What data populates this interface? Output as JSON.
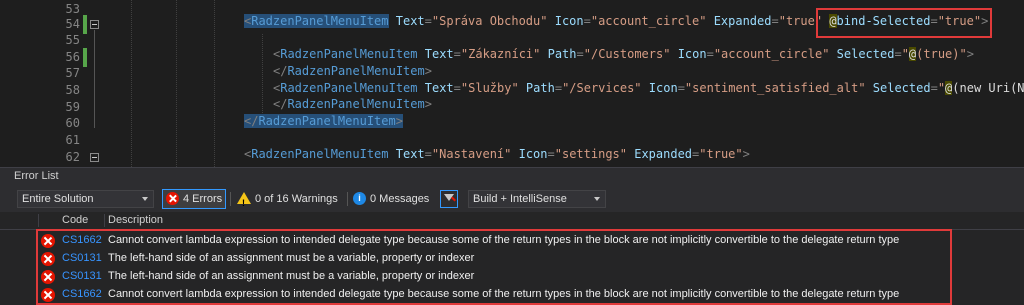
{
  "editor": {
    "line_numbers": [
      "53",
      "54",
      "55",
      "56",
      "57",
      "58",
      "59",
      "60",
      "61",
      "62"
    ],
    "lines": [
      {
        "id": "54",
        "parts": [
          [
            "punct",
            "<"
          ],
          [
            "tag",
            "RadzenPanelMenuItem"
          ],
          [
            "plain",
            " "
          ],
          [
            "attr",
            "Text"
          ],
          [
            "punct",
            "="
          ],
          [
            "str",
            "\"Správa Obchodu\""
          ],
          [
            "plain",
            " "
          ],
          [
            "attr",
            "Icon"
          ],
          [
            "punct",
            "="
          ],
          [
            "str",
            "\"account_circle\""
          ],
          [
            "plain",
            " "
          ],
          [
            "attr",
            "Expanded"
          ],
          [
            "punct",
            "="
          ],
          [
            "str",
            "\"true\""
          ],
          [
            "plain",
            " "
          ],
          [
            "razor",
            "@"
          ],
          [
            "attr",
            "bind-Selected"
          ],
          [
            "punct",
            "="
          ],
          [
            "str",
            "\"true\""
          ],
          [
            "punct",
            ">"
          ]
        ]
      },
      {
        "id": "56",
        "parts": [
          [
            "punct",
            "<"
          ],
          [
            "tag",
            "RadzenPanelMenuItem"
          ],
          [
            "plain",
            " "
          ],
          [
            "attr",
            "Text"
          ],
          [
            "punct",
            "="
          ],
          [
            "str",
            "\"Zákazníci\""
          ],
          [
            "plain",
            " "
          ],
          [
            "attr",
            "Path"
          ],
          [
            "punct",
            "="
          ],
          [
            "str",
            "\"/Customers\""
          ],
          [
            "plain",
            " "
          ],
          [
            "attr",
            "Icon"
          ],
          [
            "punct",
            "="
          ],
          [
            "str",
            "\"account_circle\""
          ],
          [
            "plain",
            " "
          ],
          [
            "attr",
            "Selected"
          ],
          [
            "punct",
            "="
          ],
          [
            "str",
            "\""
          ],
          [
            "razor",
            "@"
          ],
          [
            "str",
            "(true)\""
          ],
          [
            "punct",
            ">"
          ]
        ]
      },
      {
        "id": "57",
        "parts": [
          [
            "punct",
            "</"
          ],
          [
            "tag",
            "RadzenPanelMenuItem"
          ],
          [
            "punct",
            ">"
          ]
        ]
      },
      {
        "id": "58",
        "parts": [
          [
            "punct",
            "<"
          ],
          [
            "tag",
            "RadzenPanelMenuItem"
          ],
          [
            "plain",
            " "
          ],
          [
            "attr",
            "Text"
          ],
          [
            "punct",
            "="
          ],
          [
            "str",
            "\"Služby\""
          ],
          [
            "plain",
            " "
          ],
          [
            "attr",
            "Path"
          ],
          [
            "punct",
            "="
          ],
          [
            "str",
            "\"/Services\""
          ],
          [
            "plain",
            " "
          ],
          [
            "attr",
            "Icon"
          ],
          [
            "punct",
            "="
          ],
          [
            "str",
            "\"sentiment_satisfied_alt\""
          ],
          [
            "plain",
            " "
          ],
          [
            "attr",
            "Selected"
          ],
          [
            "punct",
            "="
          ],
          [
            "str",
            "\""
          ],
          [
            "razor",
            "@"
          ],
          [
            "plain",
            "(new Uri(Na"
          ]
        ]
      },
      {
        "id": "59",
        "parts": [
          [
            "punct",
            "</"
          ],
          [
            "tag",
            "RadzenPanelMenuItem"
          ],
          [
            "punct",
            ">"
          ]
        ]
      },
      {
        "id": "60",
        "parts": [
          [
            "punct",
            "</"
          ],
          [
            "tag",
            "RadzenPanelMenuItem"
          ],
          [
            "punct",
            ">"
          ]
        ]
      },
      {
        "id": "62",
        "parts": [
          [
            "punct",
            "<"
          ],
          [
            "tag",
            "RadzenPanelMenuItem"
          ],
          [
            "plain",
            " "
          ],
          [
            "attr",
            "Text"
          ],
          [
            "punct",
            "="
          ],
          [
            "str",
            "\"Nastavení\""
          ],
          [
            "plain",
            " "
          ],
          [
            "attr",
            "Icon"
          ],
          [
            "punct",
            "="
          ],
          [
            "str",
            "\"settings\""
          ],
          [
            "plain",
            " "
          ],
          [
            "attr",
            "Expanded"
          ],
          [
            "punct",
            "="
          ],
          [
            "str",
            "\"true\""
          ],
          [
            "punct",
            ">"
          ]
        ]
      }
    ]
  },
  "error_list": {
    "title": "Error List",
    "scope": "Entire Solution",
    "errors_btn": "4 Errors",
    "warnings_btn": "0 of 16 Warnings",
    "messages_btn": "0 Messages",
    "build_filter": "Build + IntelliSense",
    "columns": {
      "code": "Code",
      "description": "Description"
    },
    "rows": [
      {
        "code": "CS1662",
        "description": "Cannot convert lambda expression to intended delegate type because some of the return types in the block are not implicitly convertible to the delegate return type"
      },
      {
        "code": "CS0131",
        "description": "The left-hand side of an assignment must be a variable, property or indexer"
      },
      {
        "code": "CS0131",
        "description": "The left-hand side of an assignment must be a variable, property or indexer"
      },
      {
        "code": "CS1662",
        "description": "Cannot convert lambda expression to intended delegate type because some of the return types in the block are not implicitly convertible to the delegate return type"
      }
    ]
  },
  "colors": {
    "error_red": "#e51400",
    "highlight_box": "#e03a3a",
    "tag_blue": "#569cd6",
    "attr_blue": "#9cdcfe",
    "string": "#d69d85"
  }
}
